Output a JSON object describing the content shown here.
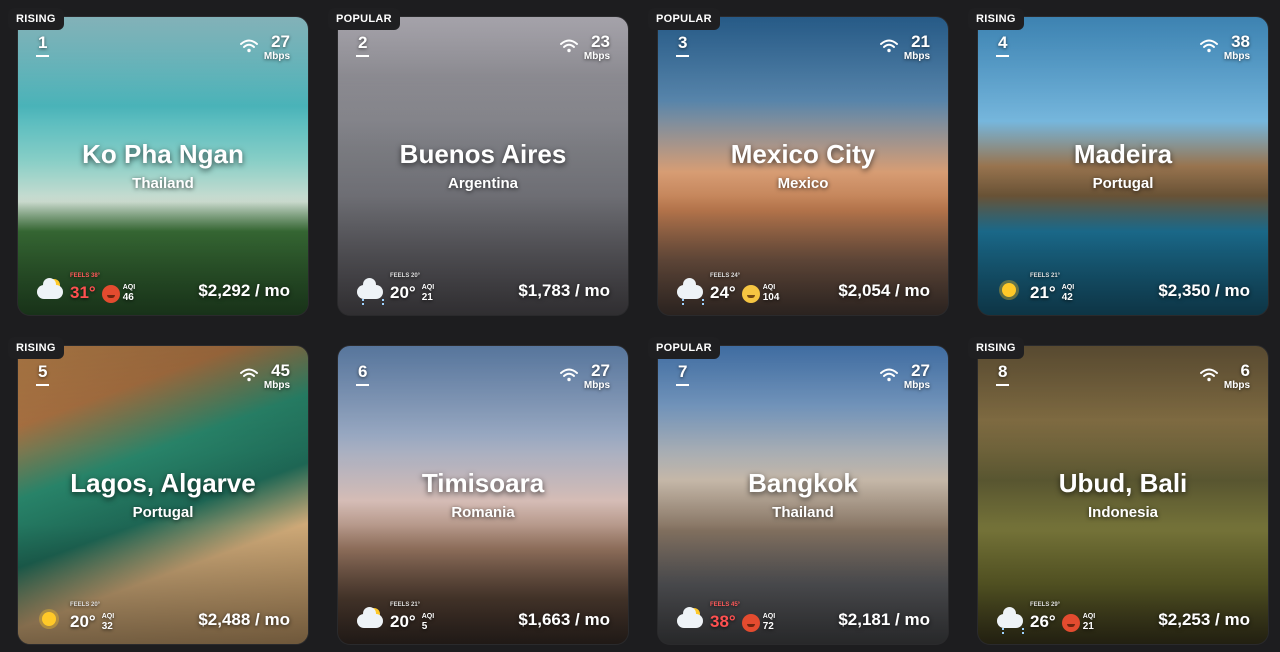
{
  "cards": [
    {
      "badge": "RISING",
      "rank": "1",
      "speed": "27",
      "unit": "Mbps",
      "name": "Ko Pha Ngan",
      "country": "Thailand",
      "weather": "partly-cloudy-icon",
      "feels": "FEELS 38°",
      "feels_hot": true,
      "temp": "31°",
      "temp_hot": true,
      "aqi_label": "AQI",
      "aqi": "46",
      "aqi_face": "hot-face-icon",
      "price": "$2,292 / mo",
      "bg": "linear-gradient(180deg,#9fd8e0 0%,#4fc0c6 30%,#8ed9d1 48%,#d8e9dc 62%,#3f7a3c 72%,#2c5b2d 100%)"
    },
    {
      "badge": "POPULAR",
      "rank": "2",
      "speed": "23",
      "unit": "Mbps",
      "name": "Buenos Aires",
      "country": "Argentina",
      "weather": "rain-icon",
      "feels": "FEELS 20°",
      "feels_hot": false,
      "temp": "20°",
      "temp_hot": false,
      "aqi_label": "AQI",
      "aqi": "21",
      "aqi_face": "",
      "price": "$1,783 / mo",
      "bg": "linear-gradient(180deg,#c9c6cf 0%,#9b9aa1 20%,#7f8086 45%,#6c6c72 70%,#575459 100%)"
    },
    {
      "badge": "POPULAR",
      "rank": "3",
      "speed": "21",
      "unit": "Mbps",
      "name": "Mexico City",
      "country": "Mexico",
      "weather": "rain-icon",
      "feels": "FEELS 24°",
      "feels_hot": false,
      "temp": "24°",
      "temp_hot": false,
      "aqi_label": "AQI",
      "aqi": "104",
      "aqi_face": "mask-face-icon",
      "price": "$2,054 / mo",
      "bg": "linear-gradient(180deg,#2f6ea4 0%,#5e8fb8 28%,#e2a57a 52%,#c57f52 65%,#7d5d4a 82%,#4e3f39 100%)"
    },
    {
      "badge": "RISING",
      "rank": "4",
      "speed": "38",
      "unit": "Mbps",
      "name": "Madeira",
      "country": "Portugal",
      "weather": "sun-icon",
      "feels": "FEELS 21°",
      "feels_hot": false,
      "temp": "21°",
      "temp_hot": false,
      "aqi_label": "AQI",
      "aqi": "42",
      "aqi_face": "",
      "price": "$2,350 / mo",
      "bg": "linear-gradient(180deg,#4a9fd8 0%,#7cc0e8 35%,#a07a53 50%,#6e5638 60%,#1f7da4 72%,#18607e 100%)"
    },
    {
      "badge": "RISING",
      "rank": "5",
      "speed": "45",
      "unit": "Mbps",
      "name": "Lagos, Algarve",
      "country": "Portugal",
      "weather": "sun-icon",
      "feels": "FEELS 20°",
      "feels_hot": false,
      "temp": "20°",
      "temp_hot": false,
      "aqi_label": "AQI",
      "aqi": "32",
      "aqi_face": "",
      "price": "$2,488 / mo",
      "bg": "linear-gradient(160deg,#c48a4f 0%,#b27745 20%,#2a8a6e 38%,#1f6b58 55%,#d9b27e 70%,#caa06b 100%)"
    },
    {
      "badge": "",
      "rank": "6",
      "speed": "27",
      "unit": "Mbps",
      "name": "Timisoara",
      "country": "Romania",
      "weather": "partly-cloudy-icon",
      "feels": "FEELS 21°",
      "feels_hot": false,
      "temp": "20°",
      "temp_hot": false,
      "aqi_label": "AQI",
      "aqi": "5",
      "aqi_face": "",
      "price": "$1,663 / mo",
      "bg": "linear-gradient(180deg,#6a8fbe 0%,#a3b4cf 30%,#e0c6bf 52%,#a17d67 68%,#5c4638 85%,#3a2e28 100%)"
    },
    {
      "badge": "POPULAR",
      "rank": "7",
      "speed": "27",
      "unit": "Mbps",
      "name": "Bangkok",
      "country": "Thailand",
      "weather": "partly-cloudy-icon",
      "feels": "FEELS 45°",
      "feels_hot": true,
      "temp": "38°",
      "temp_hot": true,
      "aqi_label": "AQI",
      "aqi": "72",
      "aqi_face": "hot-face-icon",
      "price": "$2,181 / mo",
      "bg": "linear-gradient(180deg,#4d84c4 0%,#7ea4cf 20%,#cfc1b1 45%,#8a7765 62%,#5f6064 80%,#48494c 100%)"
    },
    {
      "badge": "RISING",
      "rank": "8",
      "speed": "6",
      "unit": "Mbps",
      "name": "Ubud, Bali",
      "country": "Indonesia",
      "weather": "rain-icon",
      "feels": "FEELS 29°",
      "feels_hot": false,
      "temp": "26°",
      "temp_hot": false,
      "aqi_label": "AQI",
      "aqi": "21",
      "aqi_face": "hot-face-icon",
      "price": "$2,253 / mo",
      "bg": "linear-gradient(180deg,#6b5a3b 0%,#8a7447 25%,#5d5a33 45%,#7c7a3c 62%,#6a6a2c 80%,#3e3a1f 100%)"
    }
  ]
}
